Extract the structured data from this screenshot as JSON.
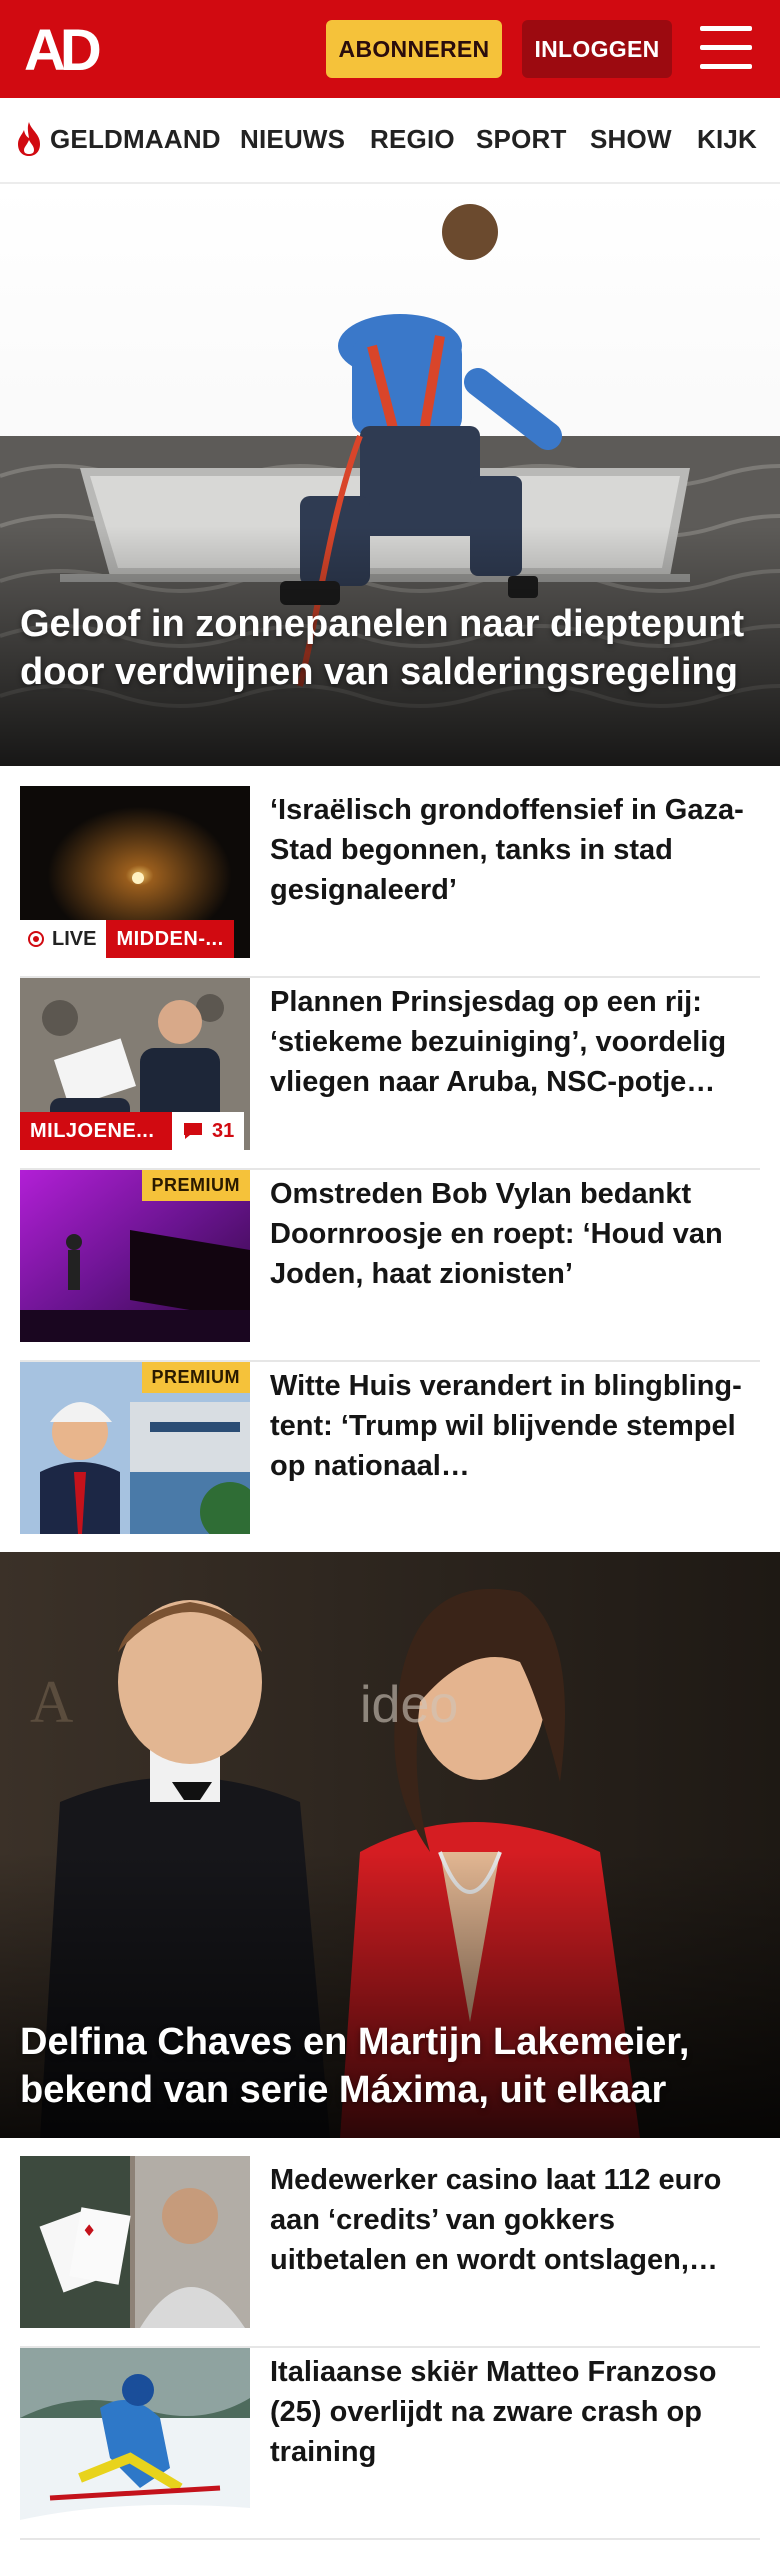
{
  "header": {
    "logo_text": "AD",
    "subscribe_label": "ABONNEREN",
    "login_label": "INLOGGEN",
    "menu_icon": "hamburger-menu-icon",
    "brand_color": "#d10a11"
  },
  "nav": {
    "items": [
      {
        "label": "GELDMAAND",
        "icon": "flame-icon"
      },
      {
        "label": "NIEUWS"
      },
      {
        "label": "REGIO"
      },
      {
        "label": "SPORT"
      },
      {
        "label": "SHOW"
      },
      {
        "label": "KIJK"
      }
    ]
  },
  "hero1": {
    "title": "Geloof in zonnepanelen naar dieptepunt door verdwijnen van salderingsregeling"
  },
  "articles": [
    {
      "title": "‘Israëlisch grondoffensief in Gaza-Stad begonnen, tanks in stad gesignaleerd’",
      "live_label": "LIVE",
      "category": "MIDDEN-..."
    },
    {
      "title": "Plannen Prinsjesdag op een rij: ‘stiekeme bezuiniging’, voordelig vliegen naar Aruba, NSC-potje…",
      "category": "MILJOENE...",
      "comments": "31"
    },
    {
      "title": "Omstreden Bob Vylan bedankt Doornroosje en roept: ‘Houd van Joden, haat zionisten’",
      "badge": "PREMIUM"
    },
    {
      "title": "Witte Huis verandert in blingbling-tent: ‘Trump wil blijvende stempel op nationaal…",
      "badge": "PREMIUM"
    }
  ],
  "hero2": {
    "title": "Delfina Chaves en Martijn Lakemeier, bekend van serie Máxima, uit elkaar"
  },
  "articles2": [
    {
      "title": "Medewerker casino laat 112 euro aan ‘credits’ van gokkers uitbetalen en wordt ontslagen,…"
    },
    {
      "title": "Italiaanse skiër Matteo Franzoso (25) overlijdt na zware crash op training"
    }
  ]
}
